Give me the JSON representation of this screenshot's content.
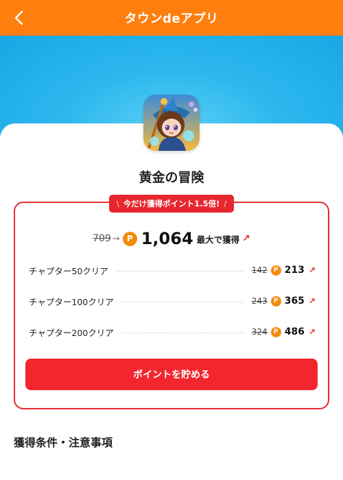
{
  "header": {
    "title": "タウンdeアプリ",
    "back_icon": "chevron-left-icon",
    "background": "#ff7f0e"
  },
  "hero": {
    "background": "#2cb8ee"
  },
  "app": {
    "name": "黄金の冒険",
    "icon": "game-character-icon"
  },
  "promo": {
    "badge_text": "今だけ獲得ポイント1.5倍!",
    "accent": "#e8262e"
  },
  "total": {
    "old_points": "709",
    "arrow": "→",
    "coin_glyph": "P",
    "new_points": "1,064",
    "suffix": "最大で獲得",
    "trend_icon": "↗"
  },
  "rewards": [
    {
      "label": "チャプター50クリア",
      "old": "142",
      "new": "213",
      "trend": "↗"
    },
    {
      "label": "チャプター100クリア",
      "old": "243",
      "new": "365",
      "trend": "↗"
    },
    {
      "label": "チャプター200クリア",
      "old": "324",
      "new": "486",
      "trend": "↗"
    }
  ],
  "cta": {
    "label": "ポイントを貯める",
    "color": "#f4262d"
  },
  "conditions": {
    "title": "獲得条件・注意事項"
  },
  "coin_color": "#f58a0b"
}
